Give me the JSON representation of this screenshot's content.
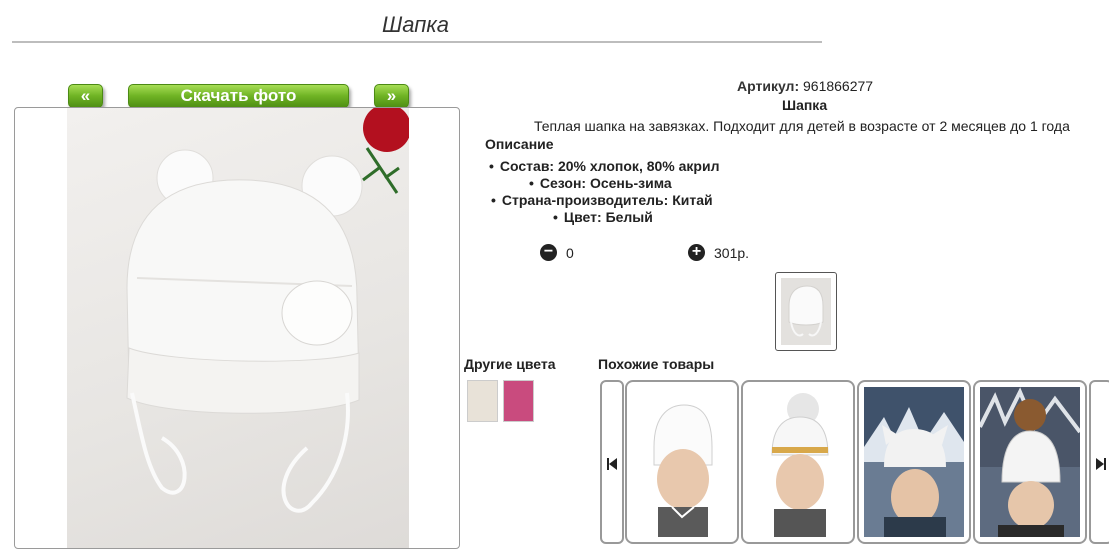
{
  "product": {
    "title": "Шапка",
    "article_label": "Артикул:",
    "article_value": "961866277",
    "name": "Шапка",
    "description": "Теплая шапка на завязках. Подходит для детей в возрасте от 2 месяцев до 1 года",
    "description_heading": "Описание",
    "specs": [
      "Состав: 20% хлопок, 80% акрил",
      "Сезон: Осень-зима",
      "Страна-производитель: Китай",
      "Цвет: Белый"
    ],
    "quantity": "0",
    "price": "301р."
  },
  "gallery": {
    "prev_label": "«",
    "download_label": "Скачать фото",
    "next_label": "»"
  },
  "other_colors": {
    "heading": "Другие цвета",
    "colors": [
      "#e8e2d8",
      "#c94b7e"
    ]
  },
  "similar": {
    "heading": "Похожие товары"
  },
  "icons": {
    "minus": "minus-circle-icon",
    "plus": "plus-circle-icon",
    "carousel_prev": "skip-prev-icon",
    "carousel_next": "skip-next-icon"
  }
}
